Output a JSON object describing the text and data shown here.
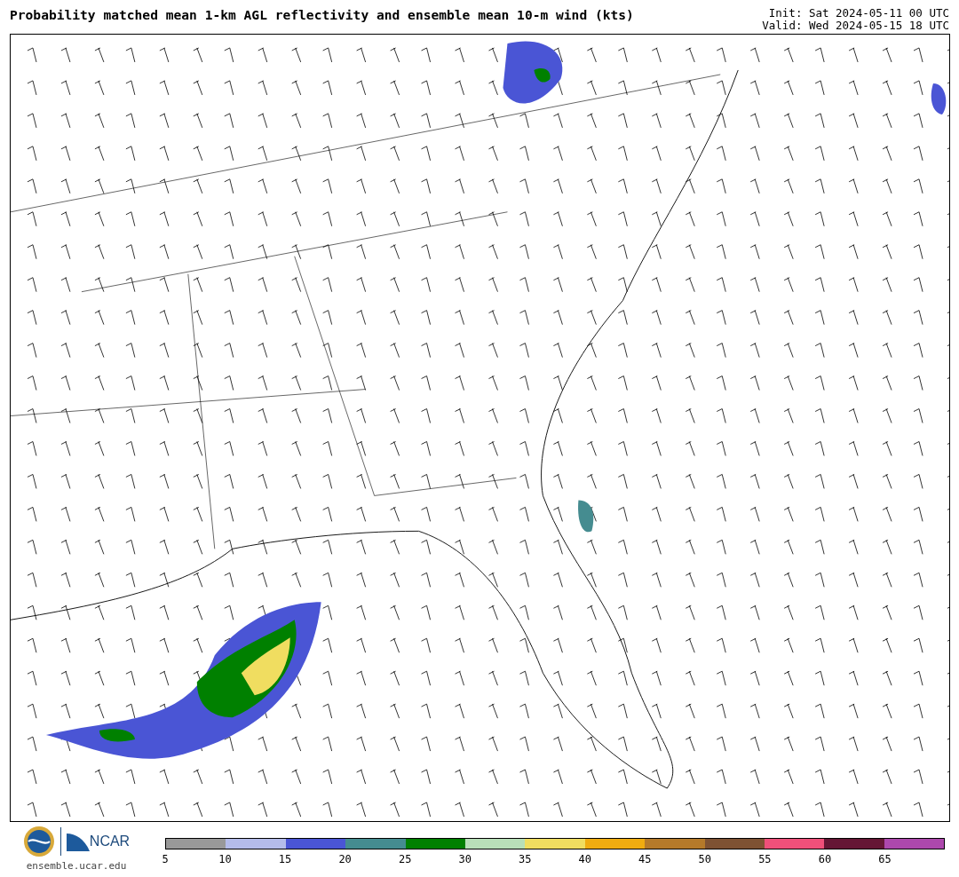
{
  "title": "Probability matched mean 1-km AGL reflectivity and ensemble mean 10-m wind (kts)",
  "init": "Init: Sat 2024-05-11 00 UTC",
  "valid": "Valid: Wed 2024-05-15 18 UTC",
  "logo": {
    "text": "NCAR",
    "url": "ensemble.ucar.edu"
  },
  "colorbar": {
    "bins": [
      {
        "color": "#999999"
      },
      {
        "color": "#b4bcea"
      },
      {
        "color": "#4a55d5"
      },
      {
        "color": "#458c90"
      },
      {
        "color": "#008000"
      },
      {
        "color": "#b8dfb8"
      },
      {
        "color": "#f0dd60"
      },
      {
        "color": "#f0ac10"
      },
      {
        "color": "#b57a2a"
      },
      {
        "color": "#7e5233"
      },
      {
        "color": "#f0507a"
      },
      {
        "color": "#651635"
      },
      {
        "color": "#ad48ad"
      }
    ],
    "ticks": [
      "5",
      "10",
      "15",
      "20",
      "25",
      "30",
      "35",
      "40",
      "45",
      "50",
      "55",
      "60",
      "65"
    ]
  }
}
